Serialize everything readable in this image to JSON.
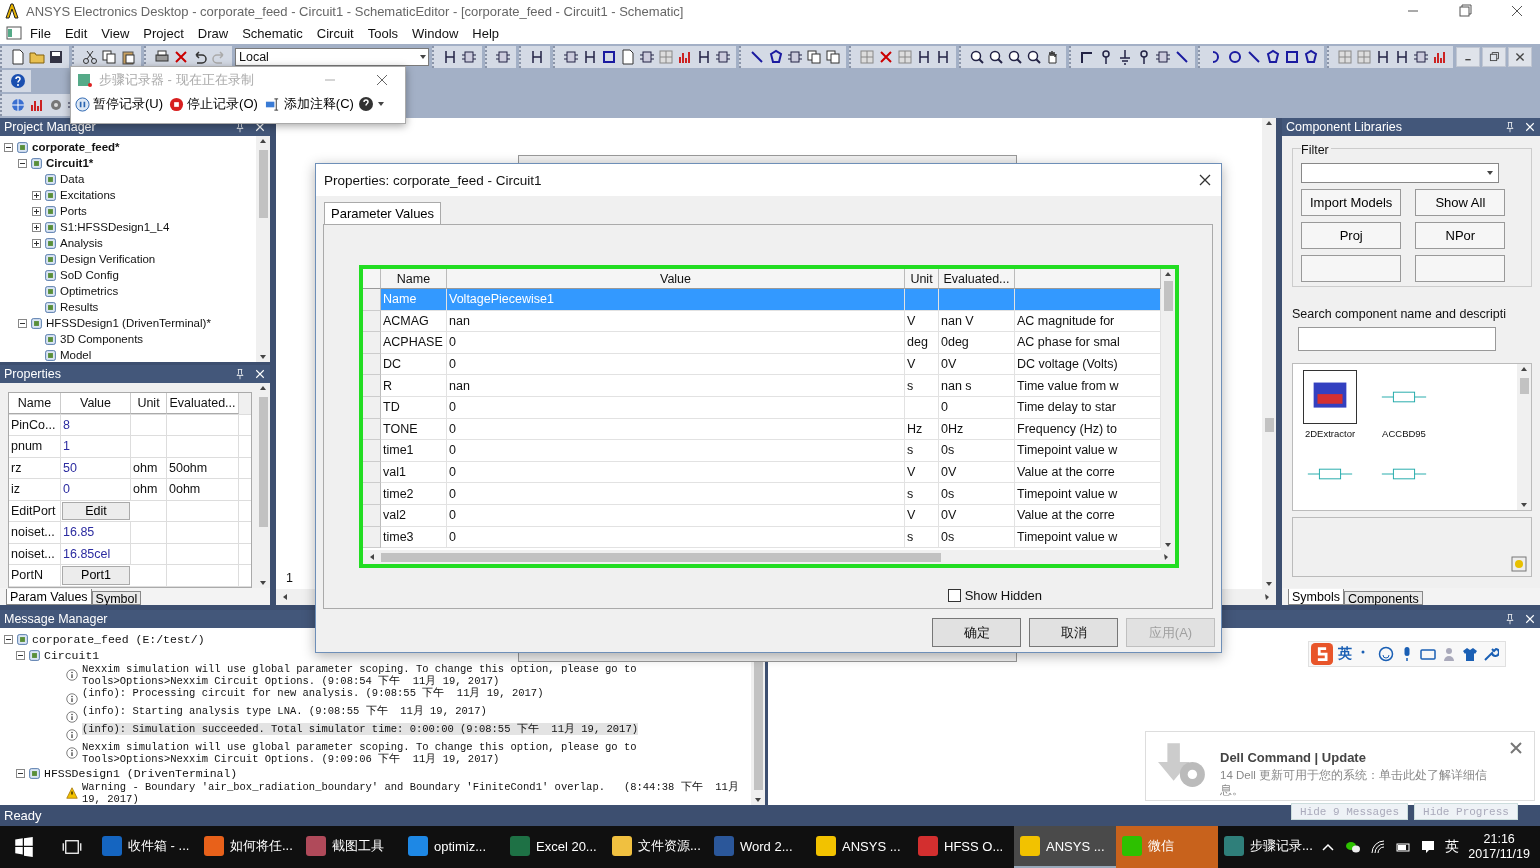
{
  "window": {
    "title": "ANSYS Electronics Desktop - corporate_feed - Circuit1 - SchematicEditor - [corporate_feed - Circuit1 - Schematic]"
  },
  "menu": [
    "File",
    "Edit",
    "View",
    "Project",
    "Draw",
    "Schematic",
    "Circuit",
    "Tools",
    "Window",
    "Help"
  ],
  "toolbar": {
    "location_select": "Local"
  },
  "step_recorder": {
    "title": "步骤记录器 - 现在正在录制",
    "buttons": [
      {
        "kind": "pause",
        "label": "暂停记录(U)"
      },
      {
        "kind": "stop",
        "label": "停止记录(O)"
      },
      {
        "kind": "note",
        "label": "添加注释(C)"
      }
    ]
  },
  "project_manager": {
    "title": "Project Manager",
    "tree": [
      {
        "label": "corporate_feed*",
        "bold": true,
        "expanded": true,
        "children": [
          {
            "label": "Circuit1*",
            "bold": true,
            "expanded": true,
            "children": [
              {
                "label": "Data",
                "bold": false
              },
              {
                "label": "Excitations",
                "bold": false,
                "expanded": false
              },
              {
                "label": "Ports",
                "bold": false,
                "expanded": false
              },
              {
                "label": "S1:HFSSDesign1_L4",
                "bold": false,
                "expanded": false
              },
              {
                "label": "Analysis",
                "bold": false,
                "expanded": false
              },
              {
                "label": "Design Verification",
                "bold": false
              },
              {
                "label": "SoD Config",
                "bold": false
              },
              {
                "label": "Optimetrics",
                "bold": false
              },
              {
                "label": "Results",
                "bold": false
              }
            ]
          },
          {
            "label": "HFSSDesign1 (DrivenTerminal)*",
            "bold": false,
            "expanded": true,
            "children": [
              {
                "label": "3D Components",
                "bold": false
              },
              {
                "label": "Model",
                "bold": false
              }
            ]
          }
        ]
      }
    ]
  },
  "properties": {
    "title": "Properties",
    "columns": [
      "Name",
      "Value",
      "Unit",
      "Evaluated..."
    ],
    "rows": [
      {
        "kind": "text",
        "name": "PinCo...",
        "value": "8"
      },
      {
        "kind": "text",
        "name": "pnum",
        "value": "1"
      },
      {
        "kind": "text",
        "name": "rz",
        "value": "50",
        "unit": "ohm",
        "evaluated": "50ohm"
      },
      {
        "kind": "text",
        "name": "iz",
        "value": "0",
        "unit": "ohm",
        "evaluated": "0ohm"
      },
      {
        "kind": "button",
        "name": "EditPort",
        "value": "Edit"
      },
      {
        "kind": "text",
        "name": "noiset...",
        "value": "16.85"
      },
      {
        "kind": "text",
        "name": "noiset...",
        "value": "16.85cel"
      },
      {
        "kind": "button",
        "name": "PortN",
        "value": "Port1"
      }
    ],
    "tabs": [
      {
        "label": "Param Values",
        "selected": true
      },
      {
        "label": "Symbol",
        "selected": false
      }
    ]
  },
  "schematic": {
    "page_number": "1"
  },
  "component_libraries": {
    "title": "Component Libraries",
    "filter_label": "Filter",
    "buttons": [
      "Import Models",
      "Show All",
      "Proj",
      "NPor"
    ],
    "search_label": "Search component name and descripti",
    "thumbnails": [
      {
        "label": "2DExtractor",
        "selected": true
      },
      {
        "label": "ACCBD95",
        "selected": false
      },
      {
        "selected": false
      },
      {
        "selected": false
      }
    ],
    "tabs": [
      {
        "label": "Symbols",
        "selected": true
      },
      {
        "label": "Components",
        "selected": false
      }
    ]
  },
  "dialog": {
    "title": "Properties: corporate_feed - Circuit1",
    "tab": "Parameter Values",
    "columns": [
      "Name",
      "Value",
      "Unit",
      "Evaluated..."
    ],
    "rows": [
      {
        "name": "Name",
        "value": "VoltagePiecewise1",
        "selected": true
      },
      {
        "name": "ACMAG",
        "value": "nan",
        "unit": "V",
        "evaluated": "nan V",
        "description": "AC magnitude for",
        "selected": false
      },
      {
        "name": "ACPHASE",
        "value": "0",
        "unit": "deg",
        "evaluated": "0deg",
        "description": "AC phase for smal",
        "selected": false
      },
      {
        "name": "DC",
        "value": "0",
        "unit": "V",
        "evaluated": "0V",
        "description": "DC voltage (Volts)",
        "selected": false
      },
      {
        "name": "R",
        "value": "nan",
        "unit": "s",
        "evaluated": "nan s",
        "description": "Time value from w",
        "selected": false
      },
      {
        "name": "TD",
        "value": "0",
        "evaluated": "0",
        "description": "Time delay to star",
        "selected": false
      },
      {
        "name": "TONE",
        "value": "0",
        "unit": "Hz",
        "evaluated": "0Hz",
        "description": "Frequency (Hz) to",
        "selected": false
      },
      {
        "name": "time1",
        "value": "0",
        "unit": "s",
        "evaluated": "0s",
        "description": "Timepoint value w",
        "selected": false
      },
      {
        "name": "val1",
        "value": "0",
        "unit": "V",
        "evaluated": "0V",
        "description": "Value at the corre",
        "selected": false
      },
      {
        "name": "time2",
        "value": "0",
        "unit": "s",
        "evaluated": "0s",
        "description": "Timepoint value w",
        "selected": false
      },
      {
        "name": "val2",
        "value": "0",
        "unit": "V",
        "evaluated": "0V",
        "description": "Value at the corre",
        "selected": false
      },
      {
        "name": "time3",
        "value": "0",
        "unit": "s",
        "evaluated": "0s",
        "description": "Timepoint value w",
        "selected": false
      }
    ],
    "show_hidden": {
      "label": "Show Hidden",
      "checked": false
    },
    "buttons": [
      {
        "label": "确定",
        "disabled": false
      },
      {
        "label": "取消",
        "disabled": false
      },
      {
        "label": "应用(A)",
        "disabled": true
      }
    ]
  },
  "message_manager": {
    "title": "Message Manager",
    "tree": [
      {
        "label": "corporate_feed (E:/test/)",
        "expanded": true,
        "children": [
          {
            "label": "Circuit1",
            "expanded": true,
            "messages": [
              {
                "kind": "info",
                "text": "Nexxim simulation will use global parameter scoping. To change this option, please go to Tools>Options>Nexxim Circuit Options. (9:08:54 下午  11月 19, 2017)",
                "selected": false
              },
              {
                "kind": "info",
                "text": "(info): Processing circuit for new analysis. (9:08:55 下午  11月 19, 2017)",
                "selected": false
              },
              {
                "kind": "info",
                "text": "(info): Starting analysis type LNA. (9:08:55 下午  11月 19, 2017)",
                "selected": false
              },
              {
                "kind": "info",
                "text": "(info): Simulation succeeded. Total simulator time: 0:00:00 (9:08:55 下午  11月 19, 2017)",
                "selected": true
              },
              {
                "kind": "info",
                "text": "Nexxim simulation will use global parameter scoping. To change this option, please go to Tools>Options>Nexxim Circuit Options. (9:09:06 下午  11月 19, 2017)",
                "selected": false
              }
            ]
          },
          {
            "label": "HFSSDesign1 (DrivenTerminal)",
            "expanded": true,
            "messages": [
              {
                "kind": "warning",
                "text": "Warning - Boundary 'air_box_radiation_boundary' and Boundary 'FiniteCond1' overlap.   (8:44:38 下午  11月 19, 2017)",
                "selected": false
              }
            ]
          }
        ]
      }
    ],
    "hide_buttons": [
      "Hide 9 Messages",
      "Hide Progress"
    ]
  },
  "ime_bar": {
    "language": "英"
  },
  "notification": {
    "title": "Dell Command | Update",
    "body": "14 Dell 更新可用于您的系统：单击此处了解详细信息。"
  },
  "status_bar": "Ready",
  "taskbar": {
    "apps": [
      {
        "label": "收件箱 - ...",
        "color": "#1565c0",
        "active": false,
        "alert": false
      },
      {
        "label": "如何将任...",
        "color": "#e8611a",
        "active": false,
        "alert": false
      },
      {
        "label": "截图工具",
        "color": "#b04a5a",
        "active": false,
        "alert": false
      },
      {
        "label": "optimiz...",
        "color": "#1e88e5",
        "active": false,
        "alert": false
      },
      {
        "label": "Excel 20...",
        "color": "#1e7145",
        "active": false,
        "alert": false
      },
      {
        "label": "文件资源...",
        "color": "#f0c040",
        "active": false,
        "alert": false
      },
      {
        "label": "Word 2...",
        "color": "#2b579a",
        "active": false,
        "alert": false
      },
      {
        "label": "ANSYS ...",
        "color": "#f2c200",
        "active": false,
        "alert": false
      },
      {
        "label": "HFSS O...",
        "color": "#d32f2f",
        "active": false,
        "alert": false
      },
      {
        "label": "ANSYS ...",
        "color": "#f2c200",
        "active": true,
        "alert": false
      },
      {
        "label": "微信",
        "color": "#2dc100",
        "active": false,
        "alert": true
      },
      {
        "label": "步骤记录...",
        "color": "#2f7f7a",
        "active": false,
        "alert": false
      }
    ],
    "language": "英",
    "time": "21:16",
    "date": "2017/11/19"
  }
}
